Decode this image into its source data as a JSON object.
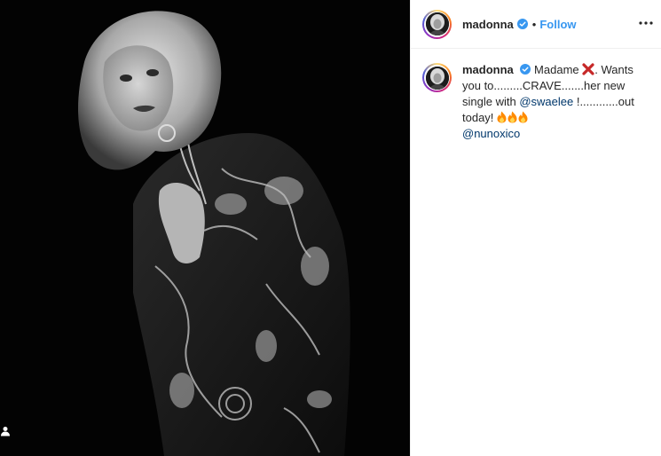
{
  "header": {
    "username": "madonna",
    "separator": "•",
    "follow_label": "Follow"
  },
  "caption": {
    "username": "madonna",
    "text_1": "Madame ",
    "text_2": ". Wants you to.........CRAVE.......her new single with ",
    "mention_1": "@swaelee",
    "text_3": " !............out today! ",
    "mention_2": "@nunoxico"
  },
  "icons": {
    "more": "more-options-icon",
    "verified": "verified-badge-icon",
    "tag": "tagged-user-icon",
    "x_emoji": "red-x-emoji",
    "fire_emoji": "fire-emoji"
  },
  "colors": {
    "follow": "#3897f0",
    "verified": "#3897f0",
    "mention": "#00376b",
    "x_emoji": "#c62828",
    "fire": "#ff8a00"
  }
}
